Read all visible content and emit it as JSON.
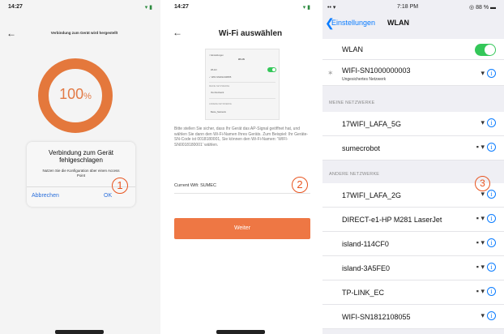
{
  "screen1": {
    "status_time": "14:27",
    "status_right": "▾ ▮",
    "back_icon": "←",
    "nav_title": "Verbindung zum Gerät wird hergestellt",
    "progress_value": 100,
    "progress_number": "100",
    "progress_unit": "%",
    "dialog": {
      "title": "Verbindung zum Gerät fehlgeschlagen",
      "message": "Nutzen Sie die Konfiguration über einen Access Point",
      "cancel_label": "Abbrechen",
      "ok_label": "OK"
    },
    "callout": "1"
  },
  "screen2": {
    "status_time": "14:27",
    "status_right": "▾ ▮",
    "back_icon": "←",
    "nav_title": "Wi-Fi auswählen",
    "thumb": {
      "back": "< Einstellungen",
      "title": "WLAN",
      "wlan": "WLAN",
      "current": "✓ WIFI-SN1812108055",
      "section1": "MEINE NETZWERKE",
      "net1": "Vier-Netzwerk",
      "section2": "ANDERE NETZWERKE",
      "net2": "Beste_Netzwerk"
    },
    "hint": "Bitte stellen Sie sicher, dass Ihr Gerät das AP-Signal geöffnet hat, und wählen Sie dann den Wi-Fi-Namen Ihres Geräts. Zum Beispiel: Ihr Geräte-SN-Code ist 0018180001, Sie können den Wi-Fi-Namen: 'WIFI-SN0018180001' wählen.",
    "current_wifi": "Current Wifi: SUMEC",
    "next_label": "Weiter",
    "callout": "2"
  },
  "screen3": {
    "status_time": "7:18 PM",
    "status_right": "◎ 88 % ▬",
    "status_signal": "•• ▾",
    "back_icon": "❮",
    "back_label": "Einstellungen",
    "title": "WLAN",
    "wlan_label": "WLAN",
    "wlan_on": true,
    "connected": {
      "name": "WIFI-SN1000000003",
      "subtitle": "Ungesichertes Netzwerk",
      "spinner": "✶"
    },
    "section_my": "MEINE NETZWERKE",
    "my_networks": [
      {
        "name": "17WIFI_LAFA_5G",
        "lock": "",
        "wifi": "▾"
      },
      {
        "name": "sumecrobot",
        "lock": "▪",
        "wifi": "▾"
      }
    ],
    "section_other": "ANDERE NETZWERKE",
    "other_networks": [
      {
        "name": "17WIFI_LAFA_2G",
        "lock": "",
        "wifi": "▾"
      },
      {
        "name": "DIRECT-e1-HP M281 LaserJet",
        "lock": "▪",
        "wifi": "▾"
      },
      {
        "name": "island-114CF0",
        "lock": "▪",
        "wifi": "▾"
      },
      {
        "name": "island-3A5FE0",
        "lock": "▪",
        "wifi": "▾"
      },
      {
        "name": "TP-LINK_EC",
        "lock": "▪",
        "wifi": "▾"
      },
      {
        "name": "WIFI-SN1812108055",
        "lock": "",
        "wifi": "▾"
      }
    ],
    "info_icon": "i",
    "callout": "3"
  }
}
